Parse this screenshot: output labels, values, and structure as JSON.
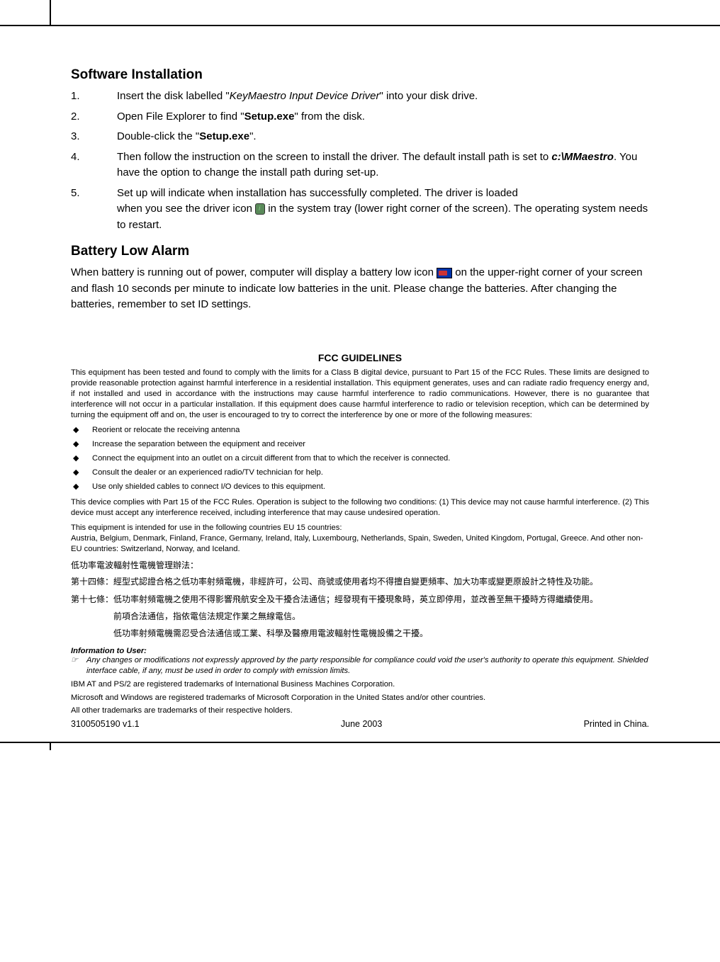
{
  "section1": {
    "title": "Software Installation",
    "items": [
      {
        "num": "1.",
        "pre": "Insert the disk labelled \"",
        "em": "KeyMaestro Input Device Driver",
        "post": "\" into your disk drive."
      },
      {
        "num": "2.",
        "pre": "Open File Explorer to find \"",
        "strong": "Setup.exe",
        "post": "\" from the disk."
      },
      {
        "num": "3.",
        "pre": "Double-click the \"",
        "strong": "Setup.exe",
        "post": "\"."
      },
      {
        "num": "4.",
        "pre": "Then follow the instruction on the screen to install the driver.  The default install path is set to ",
        "strongem": "c:\\MMaestro",
        "post": ".   You have the option to change the install path during set-up."
      },
      {
        "num": "5.",
        "line1": "Set up will indicate when installation has successfully completed. The driver is loaded",
        "line2a": "when you see the driver icon ",
        "line2b": " in the system tray  (lower right corner of the screen). The operating system needs to restart."
      }
    ]
  },
  "section2": {
    "title": "Battery Low Alarm",
    "para_a": "When battery is running out of power, computer will display a battery low icon ",
    "para_b": " on the upper-right corner of your screen and flash 10 seconds per minute to indicate low batteries in the unit. Please change the batteries. After changing the batteries, remember to set ID settings."
  },
  "fcc": {
    "title": "FCC GUIDELINES",
    "para1": "This equipment has been tested and found to comply with the limits for a Class B digital device, pursuant to Part 15 of the FCC Rules. These limits are designed to provide reasonable protection against harmful interference in a residential installation. This equipment generates, uses and can radiate radio frequency energy and, if not installed and used in accordance with the instructions may cause harmful interference to radio communications. However, there is no guarantee that interference will not occur in a particular installation. If this equipment does cause harmful interference to radio or television reception, which can be determined by turning the equipment off and on, the user is encouraged to try to correct the interference by one or more of the following measures:",
    "bullets": [
      "Reorient or relocate the receiving antenna",
      "Increase the separation between the equipment and receiver",
      "Connect the equipment into an outlet on a circuit different from that to which the receiver is connected.",
      "Consult the dealer or an experienced radio/TV technician for help.",
      "Use only shielded cables to connect I/O devices to this equipment."
    ],
    "para2": "This device complies with Part 15 of the FCC Rules. Operation is subject to the following two conditions: (1) This device may not cause harmful interference. (2) This device must accept any interference received, including interference that may cause undesired operation.",
    "para3": "This equipment is intended for use in the following countries EU 15 countries:\nAustria, Belgium, Denmark, Finland, France, Germany, Ireland, Italy, Luxembourg, Netherlands, Spain, Sweden, United Kingdom, Portugal, Greece.  And other non-EU countries: Switzerland, Norway, and Iceland."
  },
  "chinese": {
    "title": "低功率電波輻射性電機管理辦法：",
    "items": [
      {
        "label": "第十四條：",
        "text": "經型式認證合格之低功率射頻電機，非經許可，公司、商號或使用者均不得擅自變更頻率、加大功率或變更原設計之特性及功能。"
      },
      {
        "label": "第十七條：",
        "text": "低功率射頻電機之使用不得影響飛航安全及干擾合法通信；經發現有干擾現象時，英立即停用，並改善至無干擾時方得繼續使用。"
      }
    ],
    "indents": [
      "前項合法通信，指依電信法規定作業之無線電信。",
      "低功率射頻電機需忍受合法通信或工業、科學及醫療用電波輻射性電機設備之干擾。"
    ]
  },
  "info": {
    "title": "Information to User:",
    "text": "Any changes or modifications not expressly approved by the party responsible for compliance could void the user's authority to operate this equipment.  Shielded interface cable, if any, must be used in order to comply with emission limits."
  },
  "trademarks": [
    "IBM AT and PS/2 are registered trademarks of International Business Machines Corporation.",
    "Microsoft and Windows are registered trademarks of Microsoft Corporation in the United States and/or other countries.",
    "All other trademarks are trademarks of their respective holders."
  ],
  "footer": {
    "left": "3100505190 v1.1",
    "center": "June 2003",
    "right": "Printed in China."
  }
}
